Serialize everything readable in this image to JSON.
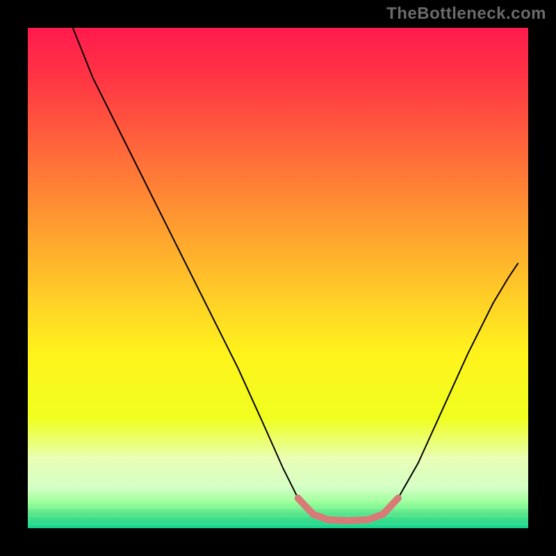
{
  "watermark": "TheBottleneck.com",
  "chart_data": {
    "type": "line",
    "title": "",
    "xlabel": "",
    "ylabel": "",
    "xlim": [
      0,
      100
    ],
    "ylim": [
      0,
      100
    ],
    "background_gradient": {
      "stops": [
        {
          "offset": 0.0,
          "color": "#ff1a4d"
        },
        {
          "offset": 0.1,
          "color": "#ff3544"
        },
        {
          "offset": 0.25,
          "color": "#ff6a3a"
        },
        {
          "offset": 0.4,
          "color": "#ff9e30"
        },
        {
          "offset": 0.55,
          "color": "#ffd226"
        },
        {
          "offset": 0.65,
          "color": "#fff31c"
        },
        {
          "offset": 0.78,
          "color": "#f0ff20"
        },
        {
          "offset": 0.86,
          "color": "#e8ffb0"
        },
        {
          "offset": 0.92,
          "color": "#d0ffc0"
        },
        {
          "offset": 0.95,
          "color": "#90ff90"
        },
        {
          "offset": 0.975,
          "color": "#40e080"
        },
        {
          "offset": 1.0,
          "color": "#00d084"
        }
      ]
    },
    "stripes": {
      "y_start": 88,
      "y_end": 100,
      "count": 18
    },
    "series": [
      {
        "name": "curve",
        "color": "#000000",
        "width": 2,
        "points": [
          {
            "x": 9,
            "y": 100
          },
          {
            "x": 13,
            "y": 90
          },
          {
            "x": 18,
            "y": 80
          },
          {
            "x": 24,
            "y": 68
          },
          {
            "x": 30,
            "y": 56
          },
          {
            "x": 36,
            "y": 44
          },
          {
            "x": 42,
            "y": 32
          },
          {
            "x": 47,
            "y": 21
          },
          {
            "x": 51,
            "y": 12
          },
          {
            "x": 54,
            "y": 6
          },
          {
            "x": 57,
            "y": 2.8
          },
          {
            "x": 60,
            "y": 1.7
          },
          {
            "x": 64,
            "y": 1.5
          },
          {
            "x": 68,
            "y": 1.7
          },
          {
            "x": 71,
            "y": 2.8
          },
          {
            "x": 74,
            "y": 6
          },
          {
            "x": 78,
            "y": 13
          },
          {
            "x": 83,
            "y": 24
          },
          {
            "x": 88,
            "y": 35
          },
          {
            "x": 93,
            "y": 45
          },
          {
            "x": 96,
            "y": 50
          },
          {
            "x": 98,
            "y": 53
          }
        ]
      },
      {
        "name": "highlight",
        "color": "#d87a78",
        "width": 10,
        "linecap": "round",
        "points": [
          {
            "x": 54,
            "y": 6
          },
          {
            "x": 57,
            "y": 2.8
          },
          {
            "x": 60,
            "y": 1.7
          },
          {
            "x": 64,
            "y": 1.5
          },
          {
            "x": 68,
            "y": 1.7
          },
          {
            "x": 71,
            "y": 2.8
          },
          {
            "x": 74,
            "y": 6
          }
        ]
      }
    ]
  }
}
